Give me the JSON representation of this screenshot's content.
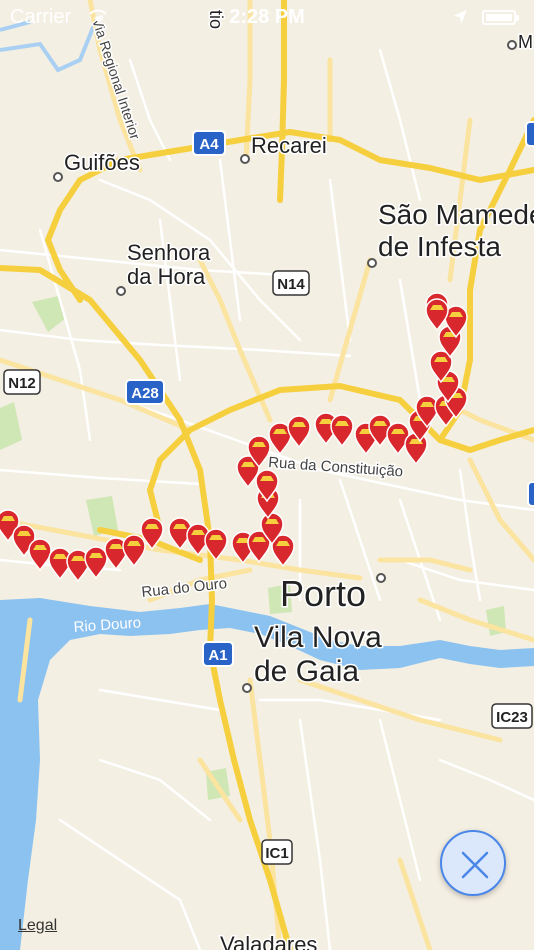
{
  "status_bar": {
    "carrier": "Carrier",
    "time": "2:28 PM",
    "wifi_icon": "wifi-icon",
    "location_icon": "location-arrow-icon",
    "battery_icon": "battery-icon"
  },
  "map": {
    "colors": {
      "land": "#f4efe3",
      "water": "#8cc2f0",
      "park": "#cfe6b5",
      "highway": "#f6cf3f",
      "major_road": "#fbe7a3",
      "minor_road": "#ffffff",
      "pin": "#d8272d"
    },
    "place_labels": {
      "guifoes": "Guifões",
      "recarei": "Recarei",
      "sao_mamede": "São Mamede",
      "de_infesta": "de Infesta",
      "senhora": "Senhora",
      "da_hora": "da Hora",
      "porto": "Porto",
      "vila_nova": "Vila Nova",
      "de_gaia": "de Gaia",
      "valadares": "Valadares",
      "m_partial": "M",
      "tio_partial": "tio"
    },
    "street_labels": {
      "via_regional": "Via Regional Interior",
      "rua_constituicao": "Rua da Constituição",
      "rua_ouro": "Rua do Ouro",
      "rio_douro": "Rio Douro"
    },
    "road_shields": {
      "a4": "A4",
      "n14": "N14",
      "n12": "N12",
      "a28": "A28",
      "a1": "A1",
      "ic23": "IC23",
      "ic1": "IC1"
    },
    "pin_icon": "map-pin-icon",
    "pin_count": 46
  },
  "controls": {
    "close_icon": "close-icon",
    "legal_label": "Legal"
  }
}
